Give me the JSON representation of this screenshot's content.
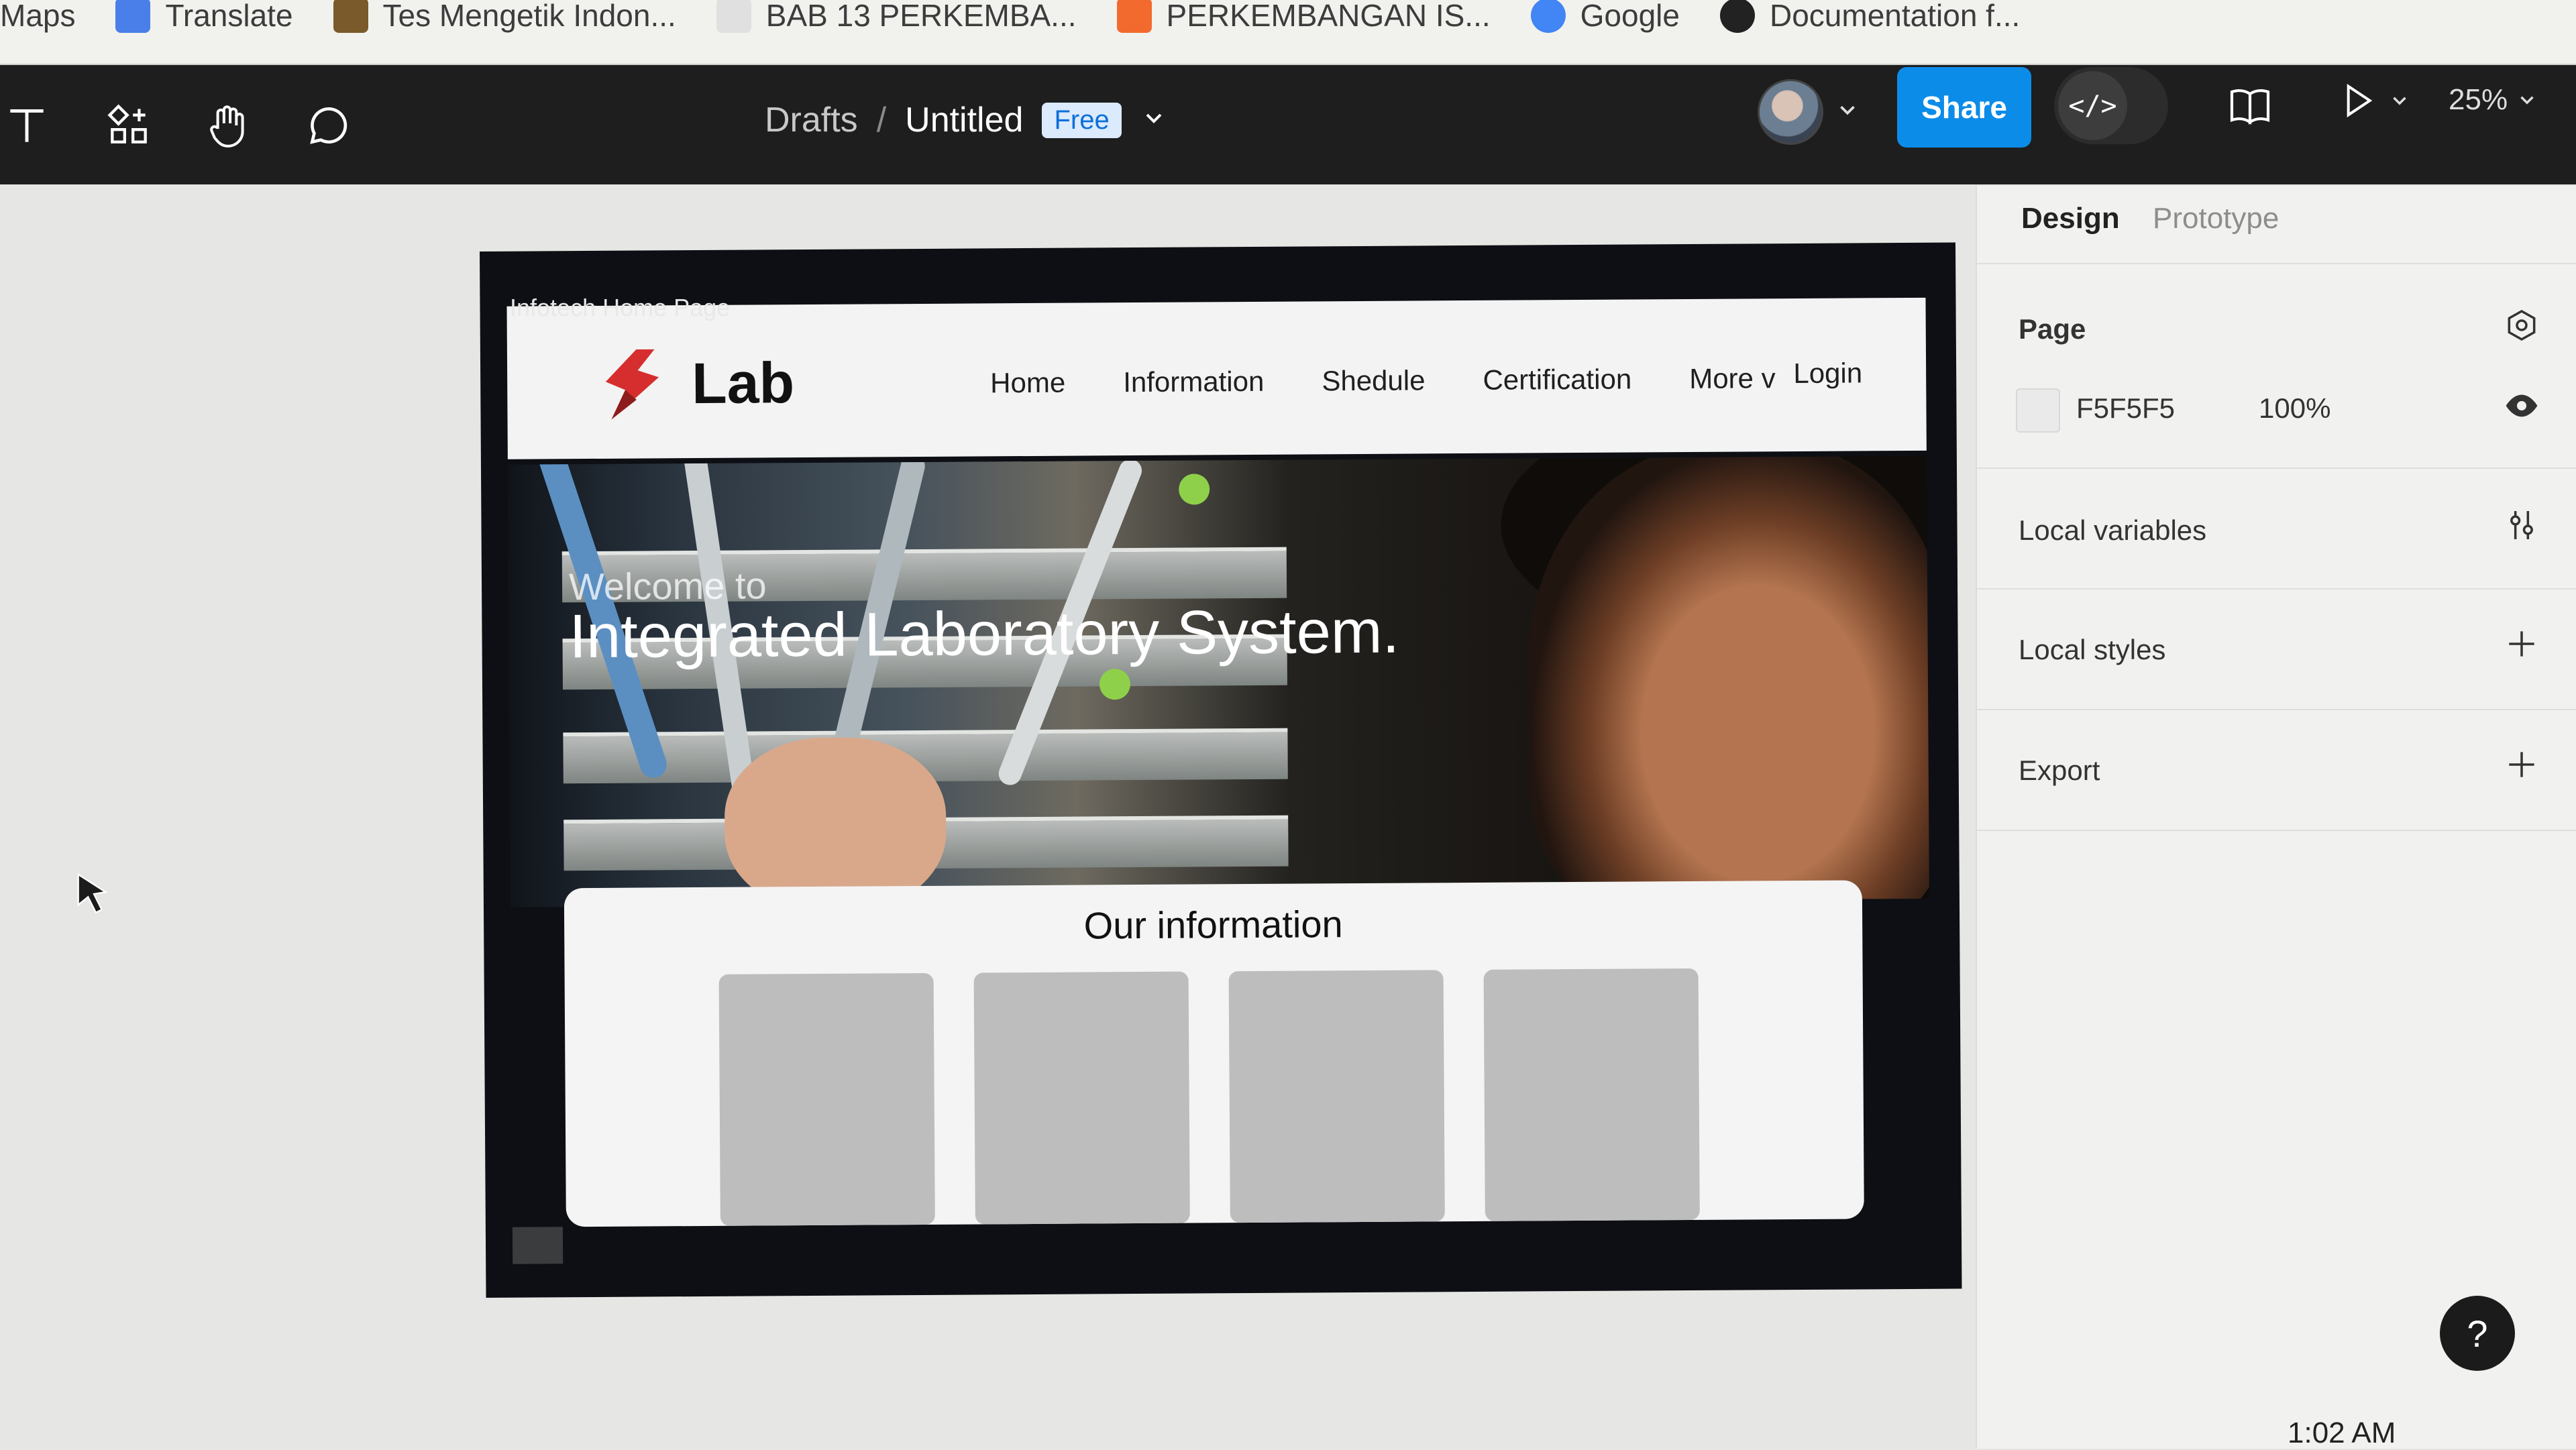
{
  "bookmarks": [
    {
      "label": "Maps",
      "color": "#4caf50"
    },
    {
      "label": "Translate",
      "color": "#4a7ee8"
    },
    {
      "label": "Tes Mengetik Indon...",
      "color": "#7a5a2a"
    },
    {
      "label": "BAB 13 PERKEMBA...",
      "color": "#e0e0e0"
    },
    {
      "label": "PERKEMBANGAN IS...",
      "color": "#f26a2e"
    },
    {
      "label": "Google",
      "color": "#4285f4"
    },
    {
      "label": "Documentation f...",
      "color": "#222222"
    }
  ],
  "toolbar": {
    "breadcrumb_drafts": "Drafts",
    "breadcrumb_sep": "/",
    "file_name": "Untitled",
    "plan_badge": "Free",
    "share_label": "Share",
    "dev_mode_icon": "</>",
    "zoom_level": "25%"
  },
  "canvas": {
    "frame_label": "Infotech Home Page",
    "site": {
      "logo_text": "Lab",
      "nav_links": [
        "Home",
        "Information",
        "Shedule",
        "Certification",
        "More v"
      ],
      "login": "Login",
      "hero_welcome": "Welcome to",
      "hero_title": "Integrated Laboratory System.",
      "info_title": "Our information"
    }
  },
  "panel": {
    "tabs": [
      "Design",
      "Prototype"
    ],
    "page_section": "Page",
    "page_hex": "F5F5F5",
    "page_opacity": "100%",
    "local_variables": "Local variables",
    "local_styles": "Local styles",
    "export": "Export"
  },
  "help_label": "?",
  "clock": "1:02 AM",
  "colors": {
    "accent": "#0c8ce9",
    "toolbar_bg": "#1e1e1e",
    "logo_red": "#d62e2e"
  }
}
